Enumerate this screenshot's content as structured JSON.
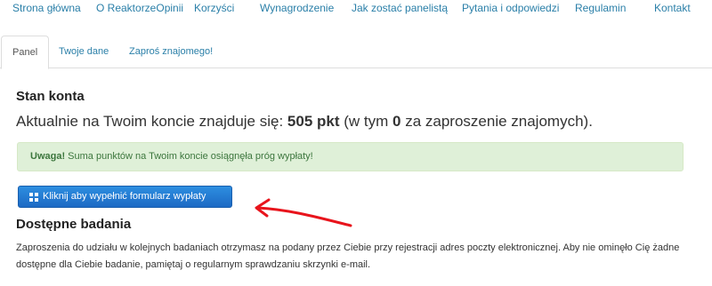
{
  "topnav": {
    "items": [
      "Strona główna",
      "O ReaktorzeOpinii",
      "Korzyści",
      "Wynagrodzenie",
      "Jak zostać panelistą",
      "Pytania i odpowiedzi",
      "Regulamin",
      "Kontakt"
    ]
  },
  "tabs": [
    {
      "label": "Panel",
      "active": true
    },
    {
      "label": "Twoje dane",
      "active": false
    },
    {
      "label": "Zaproś znajomego!",
      "active": false
    }
  ],
  "account": {
    "heading": "Stan konta",
    "balance_prefix": "Aktualnie na Twoim koncie znajduje się: ",
    "points": "505 pkt",
    "balance_mid": " (w tym ",
    "invites": "0",
    "balance_suffix": " za zaproszenie znajomych)."
  },
  "alert": {
    "strong": "Uwaga!",
    "text": " Suma punktów na Twoim koncie osiągnęła próg wypłaty!",
    "color": "#3c763d"
  },
  "payout_button": {
    "label": "Kliknij aby wypełnić formularz wypłaty",
    "icon": "grid-icon"
  },
  "surveys": {
    "heading": "Dostępne badania",
    "text": "Zaproszenia do udziału w kolejnych badaniach otrzymasz na podany przez Ciebie przy rejestracji adres poczty elektronicznej. Aby nie ominęło Cię żadne dostępne dla Ciebie badanie, pamiętaj o regularnym sprawdzaniu skrzynki e-mail."
  },
  "colors": {
    "link": "#2a7fa8",
    "button": "#1c69c4",
    "annotation_arrow": "#e8141c"
  }
}
